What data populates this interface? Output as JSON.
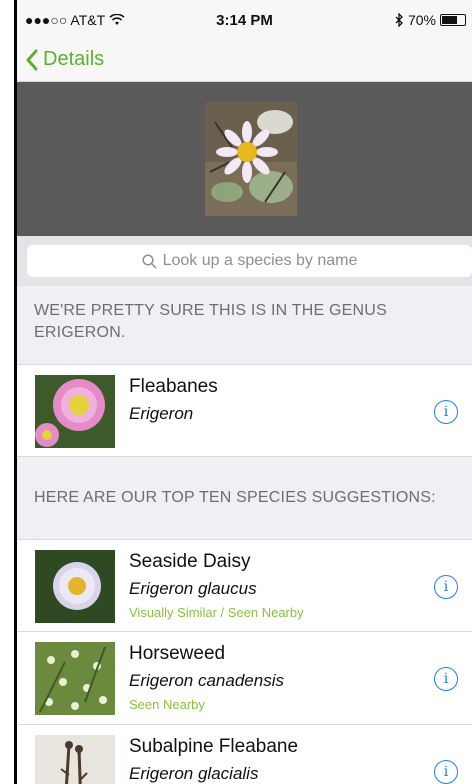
{
  "status_bar": {
    "carrier": "●●●○○ AT&T",
    "time": "3:14 PM",
    "battery": "70%",
    "battery_level": 0.7
  },
  "nav": {
    "back_label": "Details"
  },
  "search": {
    "placeholder": "Look up a species by name"
  },
  "genus_section": {
    "header": "WE'RE PRETTY SURE THIS IS IN THE GENUS ERIGERON.",
    "item": {
      "name": "Fleabanes",
      "scientific": "Erigeron",
      "icon": "info-icon"
    }
  },
  "species_section": {
    "header": "HERE ARE OUR TOP TEN SPECIES SUGGESTIONS:",
    "items": [
      {
        "name": "Seaside Daisy",
        "scientific": "Erigeron glaucus",
        "tag": "Visually Similar / Seen Nearby"
      },
      {
        "name": "Horseweed",
        "scientific": "Erigeron canadensis",
        "tag": "Seen Nearby"
      },
      {
        "name": "Subalpine Fleabane",
        "scientific": "Erigeron glacialis",
        "tag": ""
      }
    ]
  },
  "colors": {
    "accent_green": "#5bb12f",
    "tag_green": "#8cbf3f",
    "info_blue": "#1e7cf6"
  }
}
